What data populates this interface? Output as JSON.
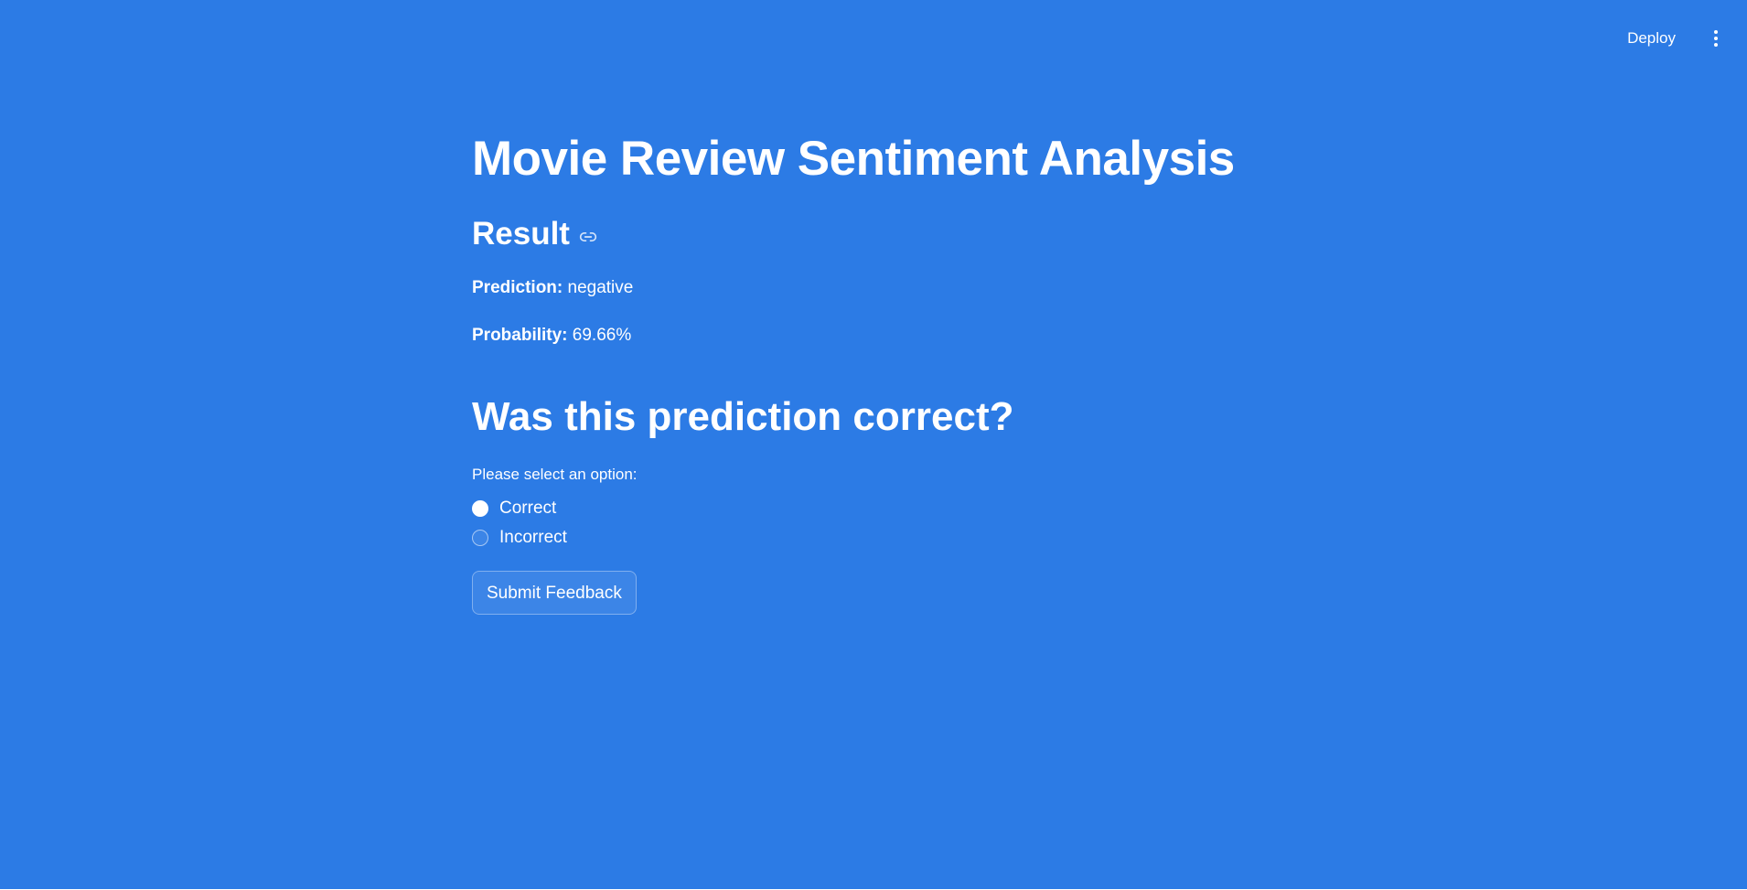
{
  "header": {
    "deploy_label": "Deploy",
    "menu_icon": "vertical-dots-icon"
  },
  "main": {
    "title": "Movie Review Sentiment Analysis",
    "result": {
      "heading": "Result",
      "link_icon": "link-icon",
      "prediction_label": "Prediction:",
      "prediction_value": "negative",
      "probability_label": "Probability:",
      "probability_value": "69.66%"
    },
    "feedback": {
      "heading": "Was this prediction correct?",
      "radio_label": "Please select an option:",
      "options": [
        {
          "label": "Correct",
          "selected": true
        },
        {
          "label": "Incorrect",
          "selected": false
        }
      ],
      "submit_label": "Submit Feedback"
    }
  },
  "colors": {
    "background": "#2c7be5",
    "text": "#ffffff"
  }
}
